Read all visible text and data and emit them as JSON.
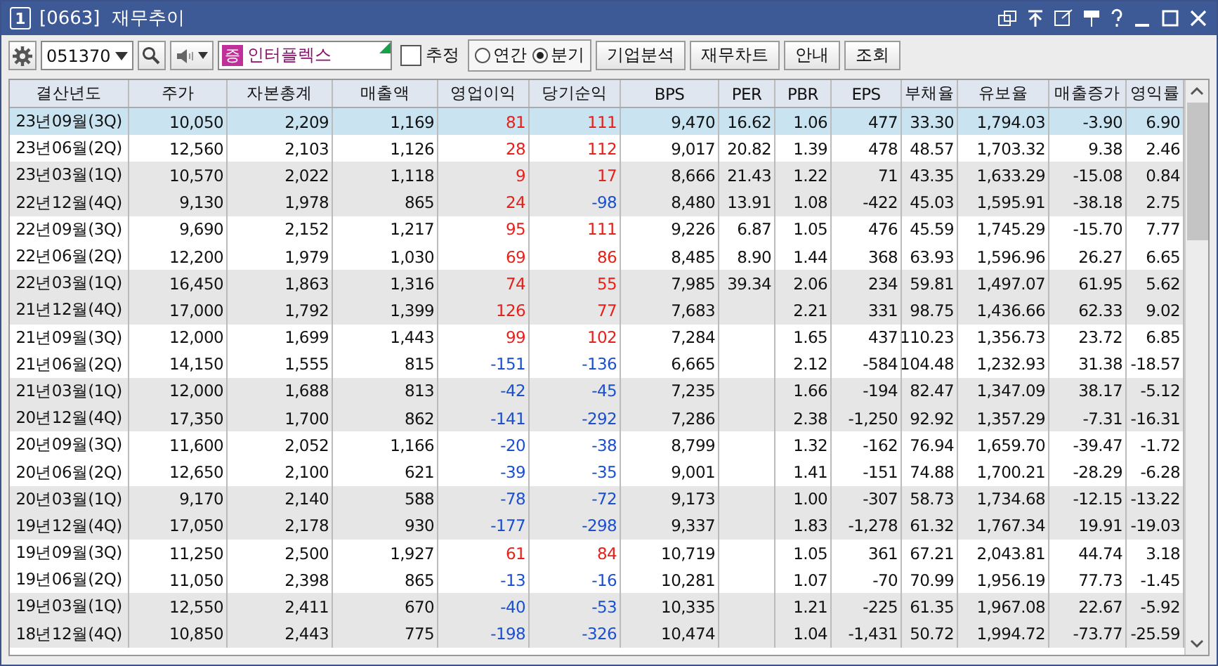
{
  "window": {
    "badge": "1",
    "title": "[0663]  재무추이"
  },
  "toolbar": {
    "code": "051370",
    "market_badge": "증",
    "stock_name": "인터플렉스",
    "estimate": {
      "label": "추정",
      "checked": false
    },
    "period": [
      {
        "label": "연간",
        "selected": false
      },
      {
        "label": "분기",
        "selected": true
      }
    ],
    "buttons": [
      "기업분석",
      "재무차트",
      "안내",
      "조회"
    ]
  },
  "table": {
    "columns": [
      "결산년도",
      "주가",
      "자본총계",
      "매출액",
      "영업이익",
      "당기순익",
      "BPS",
      "PER",
      "PBR",
      "EPS",
      "부채율",
      "유보율",
      "매출증가",
      "영익률"
    ],
    "rows": [
      {
        "selected": true,
        "cells": [
          "23년09월(3Q)",
          "10,050",
          "2,209",
          "1,169",
          {
            "text": "81",
            "color": "#e8201a"
          },
          {
            "text": "111",
            "color": "#e8201a"
          },
          "9,470",
          "16.62",
          "1.06",
          "477",
          "33.30",
          "1,794.03",
          "-3.90",
          "6.90"
        ]
      },
      {
        "selected": false,
        "cells": [
          "23년06월(2Q)",
          "12,560",
          "2,103",
          "1,126",
          {
            "text": "28",
            "color": "#e8201a"
          },
          {
            "text": "112",
            "color": "#e8201a"
          },
          "9,017",
          "20.82",
          "1.39",
          "478",
          "48.57",
          "1,703.32",
          "9.38",
          "2.46"
        ]
      },
      {
        "selected": false,
        "cells": [
          "23년03월(1Q)",
          "10,570",
          "2,022",
          "1,118",
          {
            "text": "9",
            "color": "#e8201a"
          },
          {
            "text": "17",
            "color": "#e8201a"
          },
          "8,666",
          "21.43",
          "1.22",
          "71",
          "43.35",
          "1,633.29",
          "-15.08",
          "0.84"
        ]
      },
      {
        "selected": false,
        "cells": [
          "22년12월(4Q)",
          "9,130",
          "1,978",
          "865",
          {
            "text": "24",
            "color": "#e8201a"
          },
          {
            "text": "-98",
            "color": "#1a4fd0"
          },
          "8,480",
          "13.91",
          "1.08",
          "-422",
          "45.03",
          "1,595.91",
          "-38.18",
          "2.75"
        ]
      },
      {
        "selected": false,
        "cells": [
          "22년09월(3Q)",
          "9,690",
          "2,152",
          "1,217",
          {
            "text": "95",
            "color": "#e8201a"
          },
          {
            "text": "111",
            "color": "#e8201a"
          },
          "9,226",
          "6.87",
          "1.05",
          "476",
          "45.59",
          "1,745.29",
          "-15.70",
          "7.77"
        ]
      },
      {
        "selected": false,
        "cells": [
          "22년06월(2Q)",
          "12,200",
          "1,979",
          "1,030",
          {
            "text": "69",
            "color": "#e8201a"
          },
          {
            "text": "86",
            "color": "#e8201a"
          },
          "8,485",
          "8.90",
          "1.44",
          "368",
          "63.93",
          "1,596.96",
          "26.27",
          "6.65"
        ]
      },
      {
        "selected": false,
        "cells": [
          "22년03월(1Q)",
          "16,450",
          "1,863",
          "1,316",
          {
            "text": "74",
            "color": "#e8201a"
          },
          {
            "text": "55",
            "color": "#e8201a"
          },
          "7,985",
          "39.34",
          "2.06",
          "234",
          "59.81",
          "1,497.07",
          "61.95",
          "5.62"
        ]
      },
      {
        "selected": false,
        "cells": [
          "21년12월(4Q)",
          "17,000",
          "1,792",
          "1,399",
          {
            "text": "126",
            "color": "#e8201a"
          },
          {
            "text": "77",
            "color": "#e8201a"
          },
          "7,683",
          null,
          "2.21",
          "331",
          "98.75",
          "1,436.66",
          "62.33",
          "9.02"
        ]
      },
      {
        "selected": false,
        "cells": [
          "21년09월(3Q)",
          "12,000",
          "1,699",
          "1,443",
          {
            "text": "99",
            "color": "#e8201a"
          },
          {
            "text": "102",
            "color": "#e8201a"
          },
          "7,284",
          null,
          "1.65",
          "437",
          "110.23",
          "1,356.73",
          "23.72",
          "6.85"
        ]
      },
      {
        "selected": false,
        "cells": [
          "21년06월(2Q)",
          "14,150",
          "1,555",
          "815",
          {
            "text": "-151",
            "color": "#1a4fd0"
          },
          {
            "text": "-136",
            "color": "#1a4fd0"
          },
          "6,665",
          null,
          "2.12",
          "-584",
          "104.48",
          "1,232.93",
          "31.38",
          "-18.57"
        ]
      },
      {
        "selected": false,
        "cells": [
          "21년03월(1Q)",
          "12,000",
          "1,688",
          "813",
          {
            "text": "-42",
            "color": "#1a4fd0"
          },
          {
            "text": "-45",
            "color": "#1a4fd0"
          },
          "7,235",
          null,
          "1.66",
          "-194",
          "82.47",
          "1,347.09",
          "38.17",
          "-5.12"
        ]
      },
      {
        "selected": false,
        "cells": [
          "20년12월(4Q)",
          "17,350",
          "1,700",
          "862",
          {
            "text": "-141",
            "color": "#1a4fd0"
          },
          {
            "text": "-292",
            "color": "#1a4fd0"
          },
          "7,286",
          null,
          "2.38",
          "-1,250",
          "92.92",
          "1,357.29",
          "-7.31",
          "-16.31"
        ]
      },
      {
        "selected": false,
        "cells": [
          "20년09월(3Q)",
          "11,600",
          "2,052",
          "1,166",
          {
            "text": "-20",
            "color": "#1a4fd0"
          },
          {
            "text": "-38",
            "color": "#1a4fd0"
          },
          "8,799",
          null,
          "1.32",
          "-162",
          "76.94",
          "1,659.70",
          "-39.47",
          "-1.72"
        ]
      },
      {
        "selected": false,
        "cells": [
          "20년06월(2Q)",
          "12,650",
          "2,100",
          "621",
          {
            "text": "-39",
            "color": "#1a4fd0"
          },
          {
            "text": "-35",
            "color": "#1a4fd0"
          },
          "9,001",
          null,
          "1.41",
          "-151",
          "74.88",
          "1,700.21",
          "-28.29",
          "-6.28"
        ]
      },
      {
        "selected": false,
        "cells": [
          "20년03월(1Q)",
          "9,170",
          "2,140",
          "588",
          {
            "text": "-78",
            "color": "#1a4fd0"
          },
          {
            "text": "-72",
            "color": "#1a4fd0"
          },
          "9,173",
          null,
          "1.00",
          "-307",
          "58.73",
          "1,734.68",
          "-12.15",
          "-13.22"
        ]
      },
      {
        "selected": false,
        "cells": [
          "19년12월(4Q)",
          "17,050",
          "2,178",
          "930",
          {
            "text": "-177",
            "color": "#1a4fd0"
          },
          {
            "text": "-298",
            "color": "#1a4fd0"
          },
          "9,337",
          null,
          "1.83",
          "-1,278",
          "61.32",
          "1,767.34",
          "19.91",
          "-19.03"
        ]
      },
      {
        "selected": false,
        "cells": [
          "19년09월(3Q)",
          "11,250",
          "2,500",
          "1,927",
          {
            "text": "61",
            "color": "#e8201a"
          },
          {
            "text": "84",
            "color": "#e8201a"
          },
          "10,719",
          null,
          "1.05",
          "361",
          "67.21",
          "2,043.81",
          "44.74",
          "3.18"
        ]
      },
      {
        "selected": false,
        "cells": [
          "19년06월(2Q)",
          "11,050",
          "2,398",
          "865",
          {
            "text": "-13",
            "color": "#1a4fd0"
          },
          {
            "text": "-16",
            "color": "#1a4fd0"
          },
          "10,281",
          null,
          "1.07",
          "-70",
          "70.99",
          "1,956.19",
          "77.73",
          "-1.45"
        ]
      },
      {
        "selected": false,
        "cells": [
          "19년03월(1Q)",
          "12,550",
          "2,411",
          "670",
          {
            "text": "-40",
            "color": "#1a4fd0"
          },
          {
            "text": "-53",
            "color": "#1a4fd0"
          },
          "10,335",
          null,
          "1.21",
          "-225",
          "61.35",
          "1,967.08",
          "22.67",
          "-5.92"
        ]
      },
      {
        "selected": false,
        "cells": [
          "18년12월(4Q)",
          "10,850",
          "2,443",
          "775",
          {
            "text": "-198",
            "color": "#1a4fd0"
          },
          {
            "text": "-326",
            "color": "#1a4fd0"
          },
          "10,474",
          null,
          "1.04",
          "-1,431",
          "50.72",
          "1,994.72",
          "-73.77",
          "-25.59"
        ]
      }
    ]
  }
}
